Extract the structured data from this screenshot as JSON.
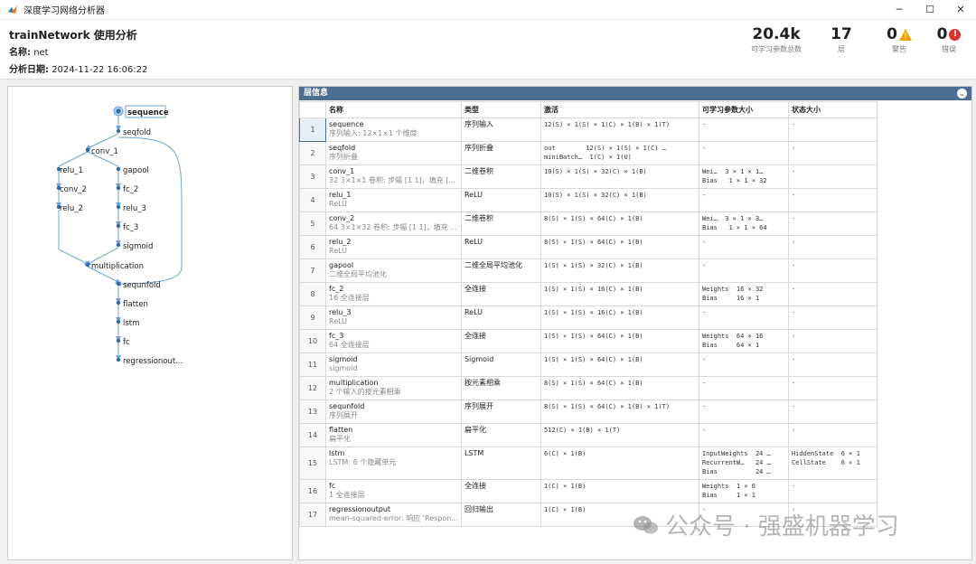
{
  "window": {
    "title": "深度学习网络分析器"
  },
  "header": {
    "title": "trainNetwork 使用分析",
    "name_label": "名称:",
    "name_value": "net",
    "date_label": "分析日期:",
    "date_value": "2024-11-22 16:06:22",
    "stats": [
      {
        "value": "20.4k",
        "label": "可学习参数总数"
      },
      {
        "value": "17",
        "label": "层"
      },
      {
        "value": "0",
        "label": "警告"
      },
      {
        "value": "0",
        "label": "错误"
      }
    ]
  },
  "graph": {
    "nodes": [
      "sequence",
      "seqfold",
      "conv_1",
      "relu_1",
      "conv_2",
      "relu_2",
      "gapool",
      "fc_2",
      "relu_3",
      "fc_3",
      "sigmoid",
      "multiplication",
      "sequnfold",
      "flatten",
      "lstm",
      "fc",
      "regressionout..."
    ]
  },
  "table": {
    "panel_title": "层信息",
    "columns": [
      "名称",
      "类型",
      "激活",
      "可学习参数大小",
      "状态大小"
    ],
    "rows": [
      {
        "i": "1",
        "name": "sequence",
        "desc": "序列输入: 12×1×1 个维度",
        "type": "序列输入",
        "act": "12(S) × 1(S) × 1(C) × 1(B) × 1(T)",
        "params": "-",
        "state": "-"
      },
      {
        "i": "2",
        "name": "seqfold",
        "desc": "序列折叠",
        "type": "序列折叠",
        "act": "out        12(S) × 1(S) × 1(C) …\nminiBatch…  1(C) × 1(U)",
        "params": "-",
        "state": "-"
      },
      {
        "i": "3",
        "name": "conv_1",
        "desc": "32 3×1×1 卷积: 步幅 [1 1]，填充 [...",
        "type": "二维卷积",
        "act": "10(S) × 1(S) × 32(C) × 1(B)",
        "params": "Wei…  3 × 1 × 1…\nBias   1 × 1 × 32",
        "state": "-"
      },
      {
        "i": "4",
        "name": "relu_1",
        "desc": "ReLU",
        "type": "ReLU",
        "act": "10(S) × 1(S) × 32(C) × 1(B)",
        "params": "-",
        "state": "-"
      },
      {
        "i": "5",
        "name": "conv_2",
        "desc": "64 3×1×32 卷积: 步幅 [1 1]，填充 ...",
        "type": "二维卷积",
        "act": "8(S) × 1(S) × 64(C) × 1(B)",
        "params": "Wei…  3 × 1 × 3…\nBias   1 × 1 × 64",
        "state": "-"
      },
      {
        "i": "6",
        "name": "relu_2",
        "desc": "ReLU",
        "type": "ReLU",
        "act": "8(S) × 1(S) × 64(C) × 1(B)",
        "params": "-",
        "state": "-"
      },
      {
        "i": "7",
        "name": "gapool",
        "desc": "二维全局平均池化",
        "type": "二维全局平均池化",
        "act": "1(S) × 1(S) × 32(C) × 1(B)",
        "params": "-",
        "state": "-"
      },
      {
        "i": "8",
        "name": "fc_2",
        "desc": "16 全连接层",
        "type": "全连接",
        "act": "1(S) × 1(S) × 16(C) × 1(B)",
        "params": "Weights  16 × 32\nBias     16 × 1",
        "state": "-"
      },
      {
        "i": "9",
        "name": "relu_3",
        "desc": "ReLU",
        "type": "ReLU",
        "act": "1(S) × 1(S) × 16(C) × 1(B)",
        "params": "-",
        "state": "-"
      },
      {
        "i": "10",
        "name": "fc_3",
        "desc": "64 全连接层",
        "type": "全连接",
        "act": "1(S) × 1(S) × 64(C) × 1(B)",
        "params": "Weights  64 × 16\nBias     64 × 1",
        "state": "-"
      },
      {
        "i": "11",
        "name": "sigmoid",
        "desc": "sigmoid",
        "type": "Sigmoid",
        "act": "1(S) × 1(S) × 64(C) × 1(B)",
        "params": "-",
        "state": "-"
      },
      {
        "i": "12",
        "name": "multiplication",
        "desc": "2 个输入的按元素相乘",
        "type": "按元素相乘",
        "act": "8(S) × 1(S) × 64(C) × 1(B)",
        "params": "-",
        "state": "-"
      },
      {
        "i": "13",
        "name": "sequnfold",
        "desc": "序列展开",
        "type": "序列展开",
        "act": "8(S) × 1(S) × 64(C) × 1(B) × 1(T)",
        "params": "-",
        "state": "-"
      },
      {
        "i": "14",
        "name": "flatten",
        "desc": "扁平化",
        "type": "扁平化",
        "act": "512(C) × 1(B) × 1(T)",
        "params": "-",
        "state": "-"
      },
      {
        "i": "15",
        "name": "lstm",
        "desc": "LSTM: 6 个隐藏单元",
        "type": "LSTM",
        "act": "6(C) × 1(B)",
        "params": "InputWeights  24 …\nRecurrentW…   24 …\nBias          24 …",
        "state": "HiddenState  6 × 1\nCellState    6 × 1"
      },
      {
        "i": "16",
        "name": "fc",
        "desc": "1 全连接层",
        "type": "全连接",
        "act": "1(C) × 1(B)",
        "params": "Weights  1 × 6\nBias     1 × 1",
        "state": "-"
      },
      {
        "i": "17",
        "name": "regressionoutput",
        "desc": "mean-squared-error: 响应 'Respon...",
        "type": "回归输出",
        "act": "1(C) × 1(B)",
        "params": "-",
        "state": "-"
      }
    ]
  },
  "watermark": {
    "text": "公众号 · 强盛机器学习"
  },
  "colors": {
    "panel_header": "#4d6e93",
    "warning": "#f0a400",
    "error": "#d9332b",
    "node": "#2a6aa8",
    "edge": "#6fa3d6"
  }
}
